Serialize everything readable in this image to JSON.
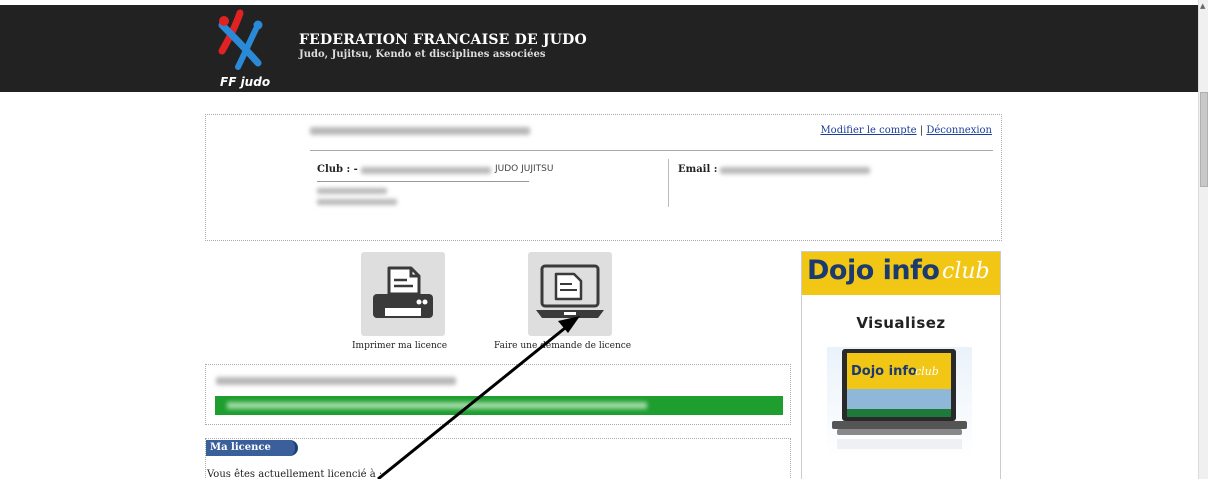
{
  "header": {
    "logo_text": "FF judo",
    "title": "FEDERATION FRANCAISE DE JUDO",
    "subtitle": "Judo, Jujitsu, Kendo et disciplines associées"
  },
  "account": {
    "modify_link": "Modifier le compte",
    "separator": "|",
    "logout_link": "Déconnexion",
    "club_label": "Club : -",
    "club_name_suffix": "JUDO JUJITSU",
    "email_label": "Email :"
  },
  "actions": {
    "print_label": "Imprimer ma licence",
    "request_label": "Faire une demande de licence"
  },
  "licence": {
    "tab_label": "Ma licence",
    "text": "Vous êtes actuellement licencié à :"
  },
  "sidebar": {
    "brand_main": "Dojo info",
    "brand_club": "club",
    "cta": "Visualisez",
    "screen_brand_main": "Dojo info",
    "screen_brand_club": "club"
  },
  "icons": {
    "logo": "ffjudo-logo-icon",
    "printer": "printer-icon",
    "laptop": "laptop-icon",
    "arrow": "annotation-arrow-icon"
  },
  "colors": {
    "header_bg": "#222222",
    "link": "#1a3e9a",
    "status_green": "#1e9e2e",
    "tab_blue": "#3a5f9a",
    "dojo_yellow": "#f2c614"
  }
}
